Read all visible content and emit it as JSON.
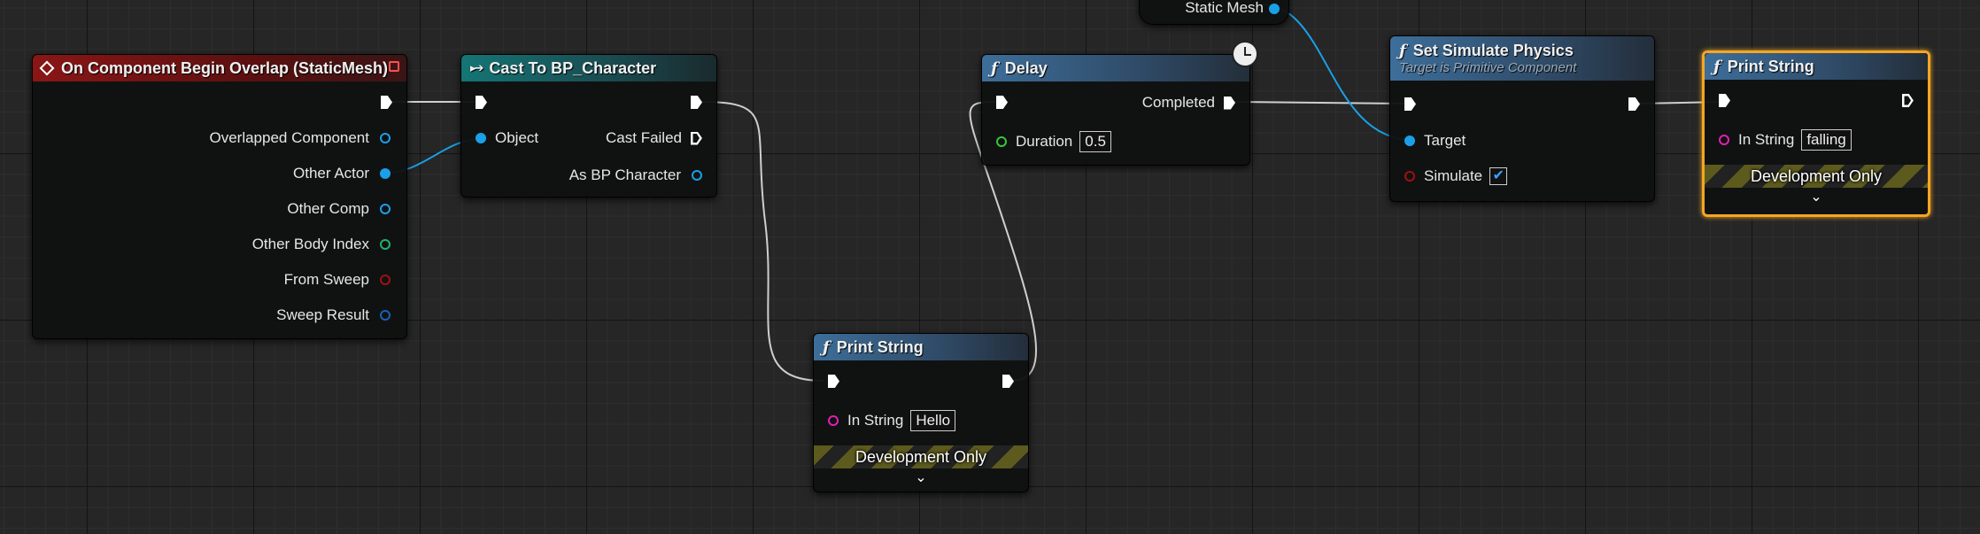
{
  "colors": {
    "exec": "#ffffff",
    "object_pin": "#1aa0e8",
    "int_pin": "#1fb36b",
    "bool_pin": "#a01010",
    "struct_pin": "#1a5fb4",
    "float_pin": "#35c935",
    "string_pin": "#e020b0",
    "selection": "#f5a623"
  },
  "nodes": {
    "overlap": {
      "title": "On Component Begin Overlap (StaticMesh)",
      "icon": "event-diamond-icon",
      "pins": {
        "overlapped_component": "Overlapped Component",
        "other_actor": "Other Actor",
        "other_comp": "Other Comp",
        "other_body_index": "Other Body Index",
        "from_sweep": "From Sweep",
        "sweep_result": "Sweep Result"
      }
    },
    "cast": {
      "title": "Cast To BP_Character",
      "icon": "cast-arrows-icon",
      "pins": {
        "object": "Object",
        "cast_failed": "Cast Failed",
        "as_bp_character": "As BP Character"
      }
    },
    "print1": {
      "title": "Print String",
      "icon": "ƒ",
      "pins": {
        "in_string": "In String"
      },
      "in_string_value": "Hello",
      "dev_only": "Development Only"
    },
    "delay": {
      "title": "Delay",
      "icon": "ƒ",
      "pins": {
        "completed": "Completed",
        "duration": "Duration"
      },
      "duration_value": "0.5"
    },
    "static_mesh": {
      "label": "Static Mesh"
    },
    "sim": {
      "title": "Set Simulate Physics",
      "subtitle": "Target is Primitive Component",
      "icon": "ƒ",
      "pins": {
        "target": "Target",
        "simulate": "Simulate"
      },
      "simulate_checked": "✔"
    },
    "print2": {
      "title": "Print String",
      "icon": "ƒ",
      "pins": {
        "in_string": "In String"
      },
      "in_string_value": "falling",
      "dev_only": "Development Only"
    }
  }
}
